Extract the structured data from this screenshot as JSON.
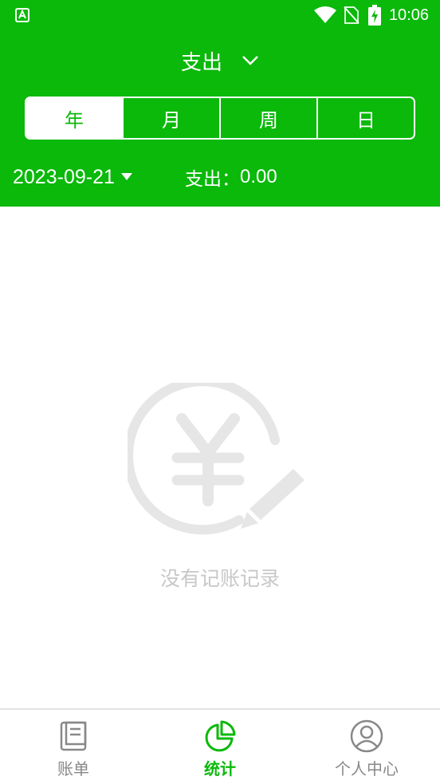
{
  "status_bar": {
    "time": "10:06"
  },
  "header": {
    "type_label": "支出",
    "period_tabs": [
      {
        "label": "年",
        "active": true
      },
      {
        "label": "月",
        "active": false
      },
      {
        "label": "周",
        "active": false
      },
      {
        "label": "日",
        "active": false
      }
    ],
    "date": "2023-09-21",
    "summary_label": "支出：",
    "summary_value": "0.00"
  },
  "empty_state": {
    "message": "没有记账记录"
  },
  "tabbar": {
    "items": [
      {
        "label": "账单",
        "icon": "bill-icon",
        "active": false
      },
      {
        "label": "统计",
        "icon": "pie-chart-icon",
        "active": true
      },
      {
        "label": "个人中心",
        "icon": "user-icon",
        "active": false
      }
    ]
  },
  "colors": {
    "primary": "#0ab90a",
    "inactive": "#888888",
    "empty": "#e6e6e6"
  }
}
